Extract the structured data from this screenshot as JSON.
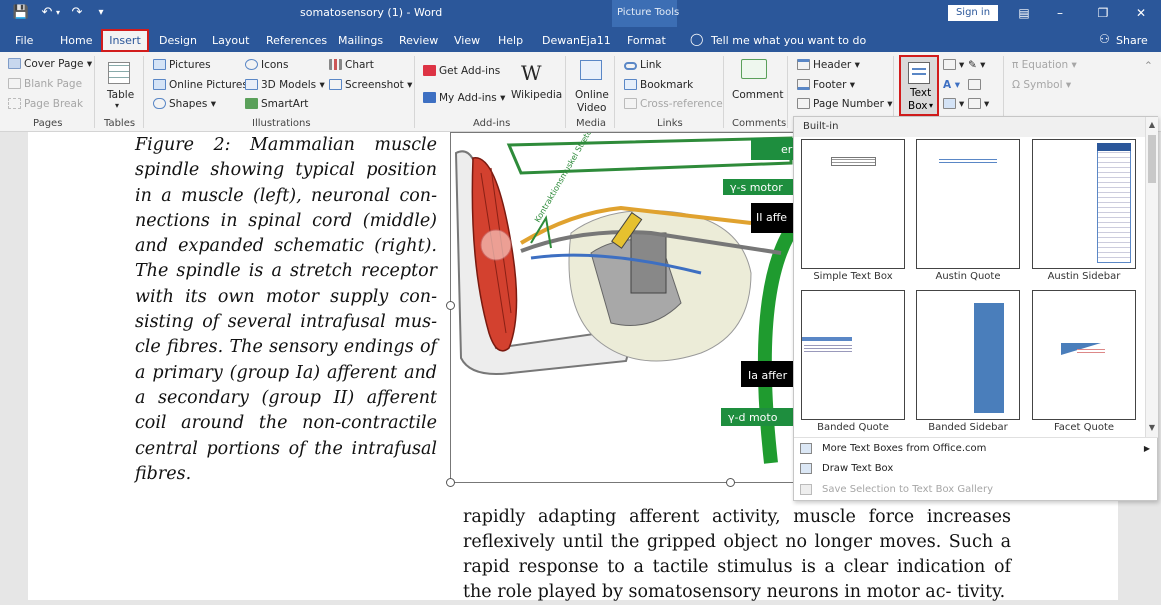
{
  "titlebar": {
    "document_title": "somatosensory (1)  -  Word",
    "picture_tools": "Picture Tools",
    "sign_in": "Sign in",
    "save_icon": "save-icon",
    "undo_icon": "undo-icon",
    "redo_icon": "redo-icon"
  },
  "tabs": {
    "file": "File",
    "home": "Home",
    "insert": "Insert",
    "design": "Design",
    "layout": "Layout",
    "references": "References",
    "mailings": "Mailings",
    "review": "Review",
    "view": "View",
    "help": "Help",
    "user": "DewanEja11",
    "format": "Format",
    "tell_me": "Tell me what you want to do",
    "share": "Share"
  },
  "ribbon": {
    "pages": {
      "cover_page": "Cover Page",
      "blank_page": "Blank Page",
      "page_break": "Page Break",
      "label": "Pages"
    },
    "tables": {
      "table": "Table",
      "label": "Tables"
    },
    "illustrations": {
      "pictures": "Pictures",
      "online_pictures": "Online Pictures",
      "shapes": "Shapes",
      "icons": "Icons",
      "models_3d": "3D Models",
      "smartart": "SmartArt",
      "chart": "Chart",
      "screenshot": "Screenshot",
      "label": "Illustrations"
    },
    "addins": {
      "get_addins": "Get Add-ins",
      "my_addins": "My Add-ins",
      "wikipedia": "Wikipedia",
      "label": "Add-ins"
    },
    "media": {
      "online": "Online",
      "video": "Video",
      "label": "Media"
    },
    "links": {
      "link": "Link",
      "bookmark": "Bookmark",
      "cross_reference": "Cross-reference",
      "label": "Links"
    },
    "comments": {
      "comment": "Comment",
      "label": "Comments"
    },
    "header_footer": {
      "header": "Header",
      "footer": "Footer",
      "page_number": "Page Number"
    },
    "text": {
      "text": "Text",
      "box": "Box"
    },
    "symbols": {
      "equation": "Equation",
      "symbol": "Symbol"
    }
  },
  "document": {
    "caption": "Figure 2: Mammalian muscle spindle showing typical position in a muscle (left), neuronal con- nections in spinal cord (middle) and expanded schematic (right). The spindle is a stretch receptor with its own motor supply con- sisting of several intrafusal mus- cle fibres. The sensory endings of a primary (group Ia) afferent and a secondary (group II) afferent coil around the non-contractile central portions of the intrafusal fibres.",
    "body": "rapidly adapting afferent activity, muscle force increases reflexively until the gripped object no longer moves. Such a rapid response to a tactile stimulus is a clear indication of the role played by somatosensory neurons in motor ac- tivity."
  },
  "figure": {
    "label_top": "er",
    "label_gamma_s": "γ-s motor",
    "label_ii": "II affe",
    "label_ia": "Ia affer",
    "label_gamma_d": "γ-d moto",
    "label_muscle": "Kontraktionsmuskel Stretchreflex"
  },
  "gallery": {
    "builtin": "Built-in",
    "items": [
      {
        "label": "Simple Text Box"
      },
      {
        "label": "Austin Quote"
      },
      {
        "label": "Austin Sidebar"
      },
      {
        "label": "Banded Quote"
      },
      {
        "label": "Banded Sidebar"
      },
      {
        "label": "Facet Quote"
      }
    ],
    "more_text_boxes": "More Text Boxes from Office.com",
    "draw_text_box": "Draw Text Box",
    "save_selection": "Save Selection to Text Box Gallery"
  }
}
